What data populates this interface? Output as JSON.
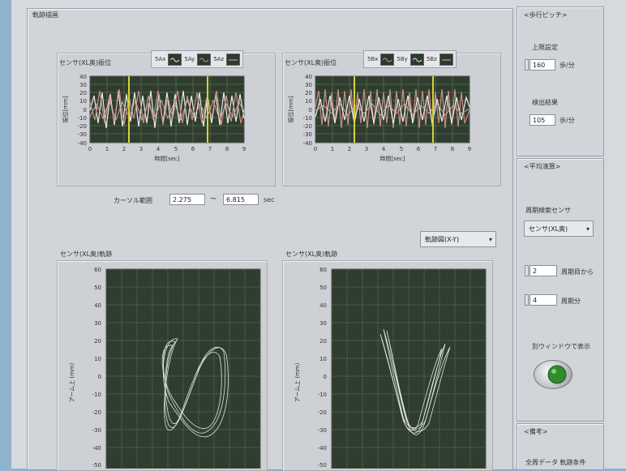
{
  "main_group": {
    "title": "軌跡描画"
  },
  "chart_tl": {
    "title": "センサ(XL奥)振位",
    "legend": [
      {
        "label": "5Ax"
      },
      {
        "label": "5Ay"
      },
      {
        "label": "5Az"
      }
    ],
    "ylabel": "振位[mm]",
    "xlabel": "時間[sec]",
    "yticks": [
      "40",
      "30",
      "20",
      "10",
      "0",
      "-10",
      "-20",
      "-30",
      "-40"
    ],
    "xticks": [
      "0",
      "1",
      "2",
      "3",
      "4",
      "5",
      "6",
      "7",
      "8",
      "9"
    ]
  },
  "chart_tr": {
    "title": "センサ(XL奥)振位",
    "legend": [
      {
        "label": "5Bx"
      },
      {
        "label": "5By"
      },
      {
        "label": "5Bz"
      }
    ],
    "ylabel": "振位[mm]",
    "xlabel": "時間[sec]",
    "yticks": [
      "40",
      "30",
      "20",
      "10",
      "0",
      "-10",
      "-20",
      "-30",
      "-40"
    ],
    "xticks": [
      "0",
      "1",
      "2",
      "3",
      "4",
      "5",
      "6",
      "7",
      "8",
      "9"
    ]
  },
  "cursor": {
    "label": "カーソル範囲",
    "from": "2.275",
    "sep": "~",
    "to": "6.815",
    "unit": "sec"
  },
  "view_dropdown": {
    "value": "軌跡図(X-Y)"
  },
  "chart_bl": {
    "title": "センサ(XL奥)軌跡",
    "ylabel": "アーム上 (mm)",
    "yticks": [
      "60",
      "50",
      "40",
      "30",
      "20",
      "10",
      "0",
      "-10",
      "-20",
      "-30",
      "-40",
      "-50"
    ]
  },
  "chart_br": {
    "title": "センサ(XL奥)軌跡",
    "ylabel": "アーム上 (mm)",
    "yticks": [
      "60",
      "50",
      "40",
      "30",
      "20",
      "10",
      "0",
      "-10",
      "-20",
      "-30",
      "-40",
      "-50"
    ]
  },
  "pitch": {
    "title": "<歩行ピッチ>",
    "upper_label": "上限設定",
    "upper_value": "160",
    "upper_unit": "歩/分",
    "measured_label": "検出結果",
    "measured_value": "105",
    "measured_unit": "歩/分"
  },
  "average": {
    "title": "<平均演算>",
    "sensor_label": "周期検索センサ",
    "sensor_value": "センサ(XL奥)",
    "from_value": "2",
    "from_label": "周期目から",
    "count_value": "4",
    "count_label": "周期分",
    "window_label": "別ウィンドウで表示"
  },
  "notes": {
    "title": "<備考>",
    "text": "全周データ 軌跡条件"
  },
  "colors": {
    "plot_bg": "#2f3d30",
    "grid": "#7f9a5c",
    "cursor": "#d8d23a",
    "trace_white": "#e6ece6",
    "trace_red": "#c98f86",
    "trace_pink": "#d7b3ae",
    "led_green": "#2e8b2e"
  }
}
